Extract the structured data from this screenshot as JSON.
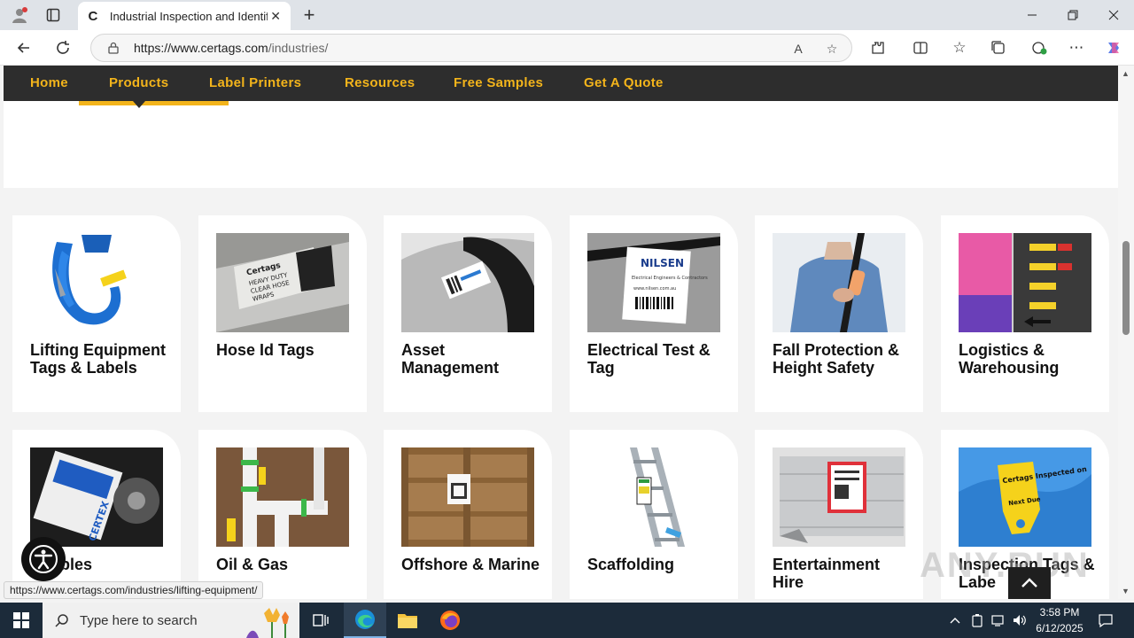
{
  "browser": {
    "tab_title": "Industrial Inspection and Identific",
    "url_domain": "https://www.certags.com",
    "url_path": "/industries/"
  },
  "nav": {
    "items": [
      "Home",
      "Products",
      "Label Printers",
      "Resources",
      "Free Samples",
      "Get A Quote"
    ],
    "active": "Products"
  },
  "cards": [
    {
      "label": "Lifting Equipment Tags & Labels"
    },
    {
      "label": "Hose Id Tags"
    },
    {
      "label": "Asset Management"
    },
    {
      "label": "Electrical Test & Tag"
    },
    {
      "label": "Fall Protection & Height Safety"
    },
    {
      "label": "Logistics & Warehousing"
    },
    {
      "label": "ewables"
    },
    {
      "label": "Oil & Gas"
    },
    {
      "label": "Offshore & Marine"
    },
    {
      "label": "Scaffolding"
    },
    {
      "label": "Entertainment Hire"
    },
    {
      "label": "Inspection Tags & Labe"
    }
  ],
  "image_text": {
    "hose": "Certags HEAVY DUTY CLEAR HOSE WRAPS",
    "nilsen": "NILSEN",
    "nilsen_sub": "Electrical Engineers & Contractors",
    "nilsen_url": "www.nilsen.com.au",
    "certex": "CERTEX",
    "inspect": "Certags Inspected on",
    "next_due": "Next Due"
  },
  "status_url": "https://www.certags.com/industries/lifting-equipment/",
  "watermark": "ANY.RUN",
  "taskbar": {
    "search_placeholder": "Type here to search",
    "time": "3:58 PM",
    "date": "6/12/2025"
  },
  "colors": {
    "nav_bg": "#2d2d2d",
    "nav_text": "#f3b41b",
    "band_bg": "#f3f3f3"
  }
}
